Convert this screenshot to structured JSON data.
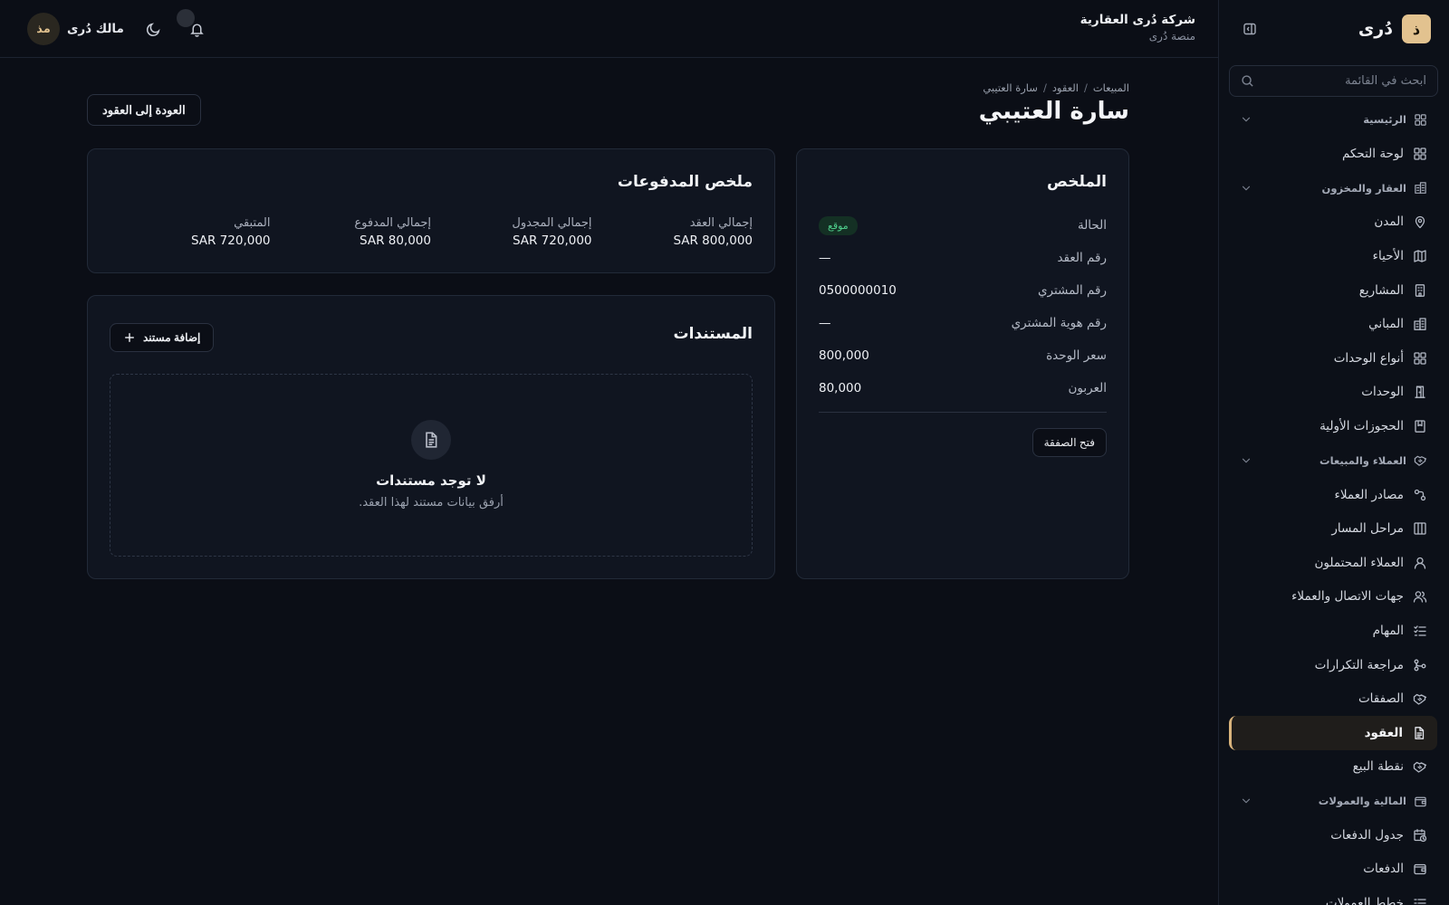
{
  "brand": {
    "logo_letter": "ذ",
    "name": "دُرى"
  },
  "sidebar": {
    "search_placeholder": "ابحث في القائمة",
    "groups": [
      {
        "label": "الرئيسية",
        "items": [
          {
            "label": "لوحة التحكم",
            "icon": "dashboard-icon"
          }
        ]
      },
      {
        "label": "العقار والمخزون",
        "items": [
          {
            "label": "المدن",
            "icon": "map-pin-icon"
          },
          {
            "label": "الأحياء",
            "icon": "map-icon"
          },
          {
            "label": "المشاريع",
            "icon": "building-icon"
          },
          {
            "label": "المباني",
            "icon": "buildings-icon"
          },
          {
            "label": "أنواع الوحدات",
            "icon": "grid-icon"
          },
          {
            "label": "الوحدات",
            "icon": "door-icon"
          },
          {
            "label": "الحجوزات الأولية",
            "icon": "bookmark-icon"
          }
        ]
      },
      {
        "label": "العملاء والمبيعات",
        "items": [
          {
            "label": "مصادر العملاء",
            "icon": "source-icon"
          },
          {
            "label": "مراحل المسار",
            "icon": "columns-icon"
          },
          {
            "label": "العملاء المحتملون",
            "icon": "user-icon"
          },
          {
            "label": "جهات الاتصال والعملاء",
            "icon": "users-icon"
          },
          {
            "label": "المهام",
            "icon": "tasks-icon"
          },
          {
            "label": "مراجعة التكرارات",
            "icon": "merge-icon"
          },
          {
            "label": "الصفقات",
            "icon": "handshake-icon"
          },
          {
            "label": "العقود",
            "icon": "document-icon",
            "active": true
          },
          {
            "label": "نقطة البيع",
            "icon": "handshake-icon"
          }
        ]
      },
      {
        "label": "المالية والعمولات",
        "items": [
          {
            "label": "جدول الدفعات",
            "icon": "calendar-clock-icon"
          },
          {
            "label": "الدفعات",
            "icon": "wallet-icon"
          },
          {
            "label": "خطط العمولات",
            "icon": "list-icon"
          }
        ]
      }
    ]
  },
  "header": {
    "company_name": "شركة دُرى العقارية",
    "company_sub": "منصة دُرى",
    "user_initials": "مذ",
    "user_name": "مالك دُرى"
  },
  "breadcrumb": [
    "المبيعات",
    "العقود",
    "سارة العتيبي"
  ],
  "page": {
    "title": "سارة العتيبي",
    "back_label": "العودة إلى العقود"
  },
  "summary": {
    "title": "الملخص",
    "rows": [
      {
        "label": "الحالة",
        "value": "موقع",
        "badge": true
      },
      {
        "label": "رقم العقد",
        "value": "—"
      },
      {
        "label": "رقم المشتري",
        "value": "0500000010"
      },
      {
        "label": "رقم هوية المشتري",
        "value": "—"
      },
      {
        "label": "سعر الوحدة",
        "value": "800,000"
      },
      {
        "label": "العربون",
        "value": "80,000"
      }
    ],
    "open_deal_label": "فتح الصفقة"
  },
  "payments": {
    "title": "ملخص المدفوعات",
    "columns": [
      {
        "label": "إجمالي العقد",
        "value": "800,000 SAR"
      },
      {
        "label": "إجمالي المجدول",
        "value": "720,000 SAR"
      },
      {
        "label": "إجمالي المدفوع",
        "value": "80,000 SAR"
      },
      {
        "label": "المتبقي",
        "value": "720,000 SAR"
      }
    ]
  },
  "documents": {
    "title": "المستندات",
    "add_label": "إضافة مستند",
    "empty_title": "لا توجد مستندات",
    "empty_sub": "أرفق بيانات مستند لهذا العقد."
  }
}
